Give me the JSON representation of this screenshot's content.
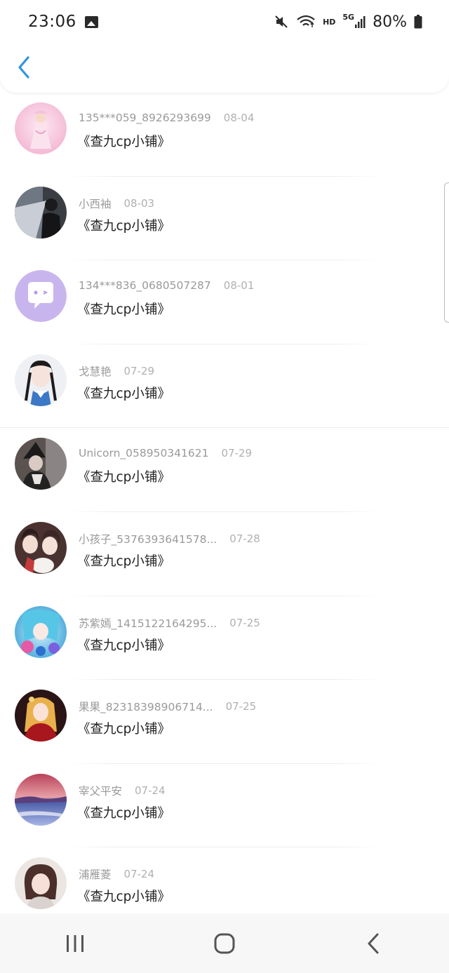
{
  "status_bar": {
    "time": "23:06",
    "icons": [
      "gallery-icon",
      "mute-icon",
      "wifi-icon",
      "hd-icon",
      "5g-signal-icon",
      "battery-icon"
    ],
    "hd_label": "HD",
    "network_label": "5G",
    "battery": "80%"
  },
  "header": {
    "back_icon": "chevron-left-icon",
    "accent_color": "#2f95e0"
  },
  "list": [
    {
      "name": "135***059_8926293699",
      "date": "08-04",
      "text": "《查九cp小铺》",
      "avatar": "pink-princess"
    },
    {
      "name": "小西袖",
      "date": "08-03",
      "text": "《查九cp小铺》",
      "avatar": "dark-girl"
    },
    {
      "name": "134***836_0680507287",
      "date": "08-01",
      "text": "《查九cp小铺》",
      "avatar": "purple-chat-bubble"
    },
    {
      "name": "戈慧艳",
      "date": "07-29",
      "text": "《查九cp小铺》",
      "avatar": "girl-braids"
    },
    {
      "name": "Unicorn_058950341621",
      "date": "07-29",
      "text": "《查九cp小铺》",
      "avatar": "dark-hat"
    },
    {
      "name": "小孩子_5376393641578...",
      "date": "07-28",
      "text": "《查九cp小铺》",
      "avatar": "anime-couple"
    },
    {
      "name": "苏紫嫣_1415122164295...",
      "date": "07-25",
      "text": "《查九cp小铺》",
      "avatar": "anime-blue-hair"
    },
    {
      "name": "果果_82318398906714...",
      "date": "07-25",
      "text": "《查九cp小铺》",
      "avatar": "anime-red-dress"
    },
    {
      "name": "宰父平安",
      "date": "07-24",
      "text": "《查九cp小铺》",
      "avatar": "sunset-sea"
    },
    {
      "name": "浦雁菱",
      "date": "07-24",
      "text": "《查九cp小铺》",
      "avatar": "girl-bob-hair"
    }
  ],
  "nav_bar": {
    "icons": [
      "recent-apps-icon",
      "home-icon",
      "back-icon"
    ]
  }
}
